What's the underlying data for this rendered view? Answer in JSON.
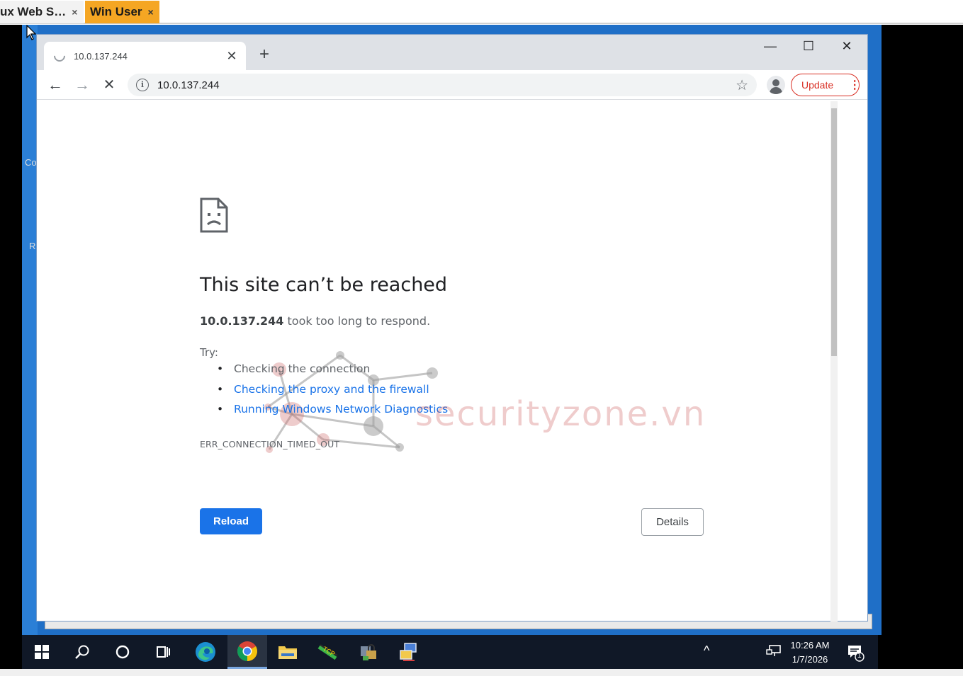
{
  "host_tabs": [
    {
      "label": "ux Web S…",
      "close": "×"
    },
    {
      "label": "Win User",
      "close": "×"
    }
  ],
  "desktop": {
    "label_co": "Co",
    "label_r": "R"
  },
  "browser": {
    "tab_title": "10.0.137.244",
    "tab_close": "✕",
    "new_tab": "+",
    "window_controls": {
      "minimize": "—",
      "maximize": "☐",
      "close": "✕"
    },
    "back": "←",
    "forward": "→",
    "stop": "✕",
    "url": "10.0.137.244",
    "star": "☆",
    "update_label": "Update",
    "menu_dots": "⋮"
  },
  "error_page": {
    "headline": "This site can’t be reached",
    "host_bold": "10.0.137.244",
    "host_rest": " took too long to respond.",
    "try_label": "Try:",
    "suggestions": [
      {
        "text": "Checking the connection",
        "link": false
      },
      {
        "text": "Checking the proxy and the firewall",
        "link": true
      },
      {
        "text": "Running Windows Network Diagnostics",
        "link": true
      }
    ],
    "error_code": "ERR_CONNECTION_TIMED_OUT",
    "reload_label": "Reload",
    "details_label": "Details"
  },
  "watermark": {
    "text": "securityzone.vn"
  },
  "taskbar": {
    "items": [
      "start-icon",
      "search-icon",
      "cortana-icon",
      "task-view-icon",
      "edge-icon",
      "chrome-icon",
      "file-explorer-icon",
      "network-tool-icon",
      "lock-tool-icon",
      "remote-tool-icon"
    ],
    "tray_chevron": "^",
    "time": "10:26 AM",
    "date": "1/7/2026",
    "notification_count": "1"
  }
}
